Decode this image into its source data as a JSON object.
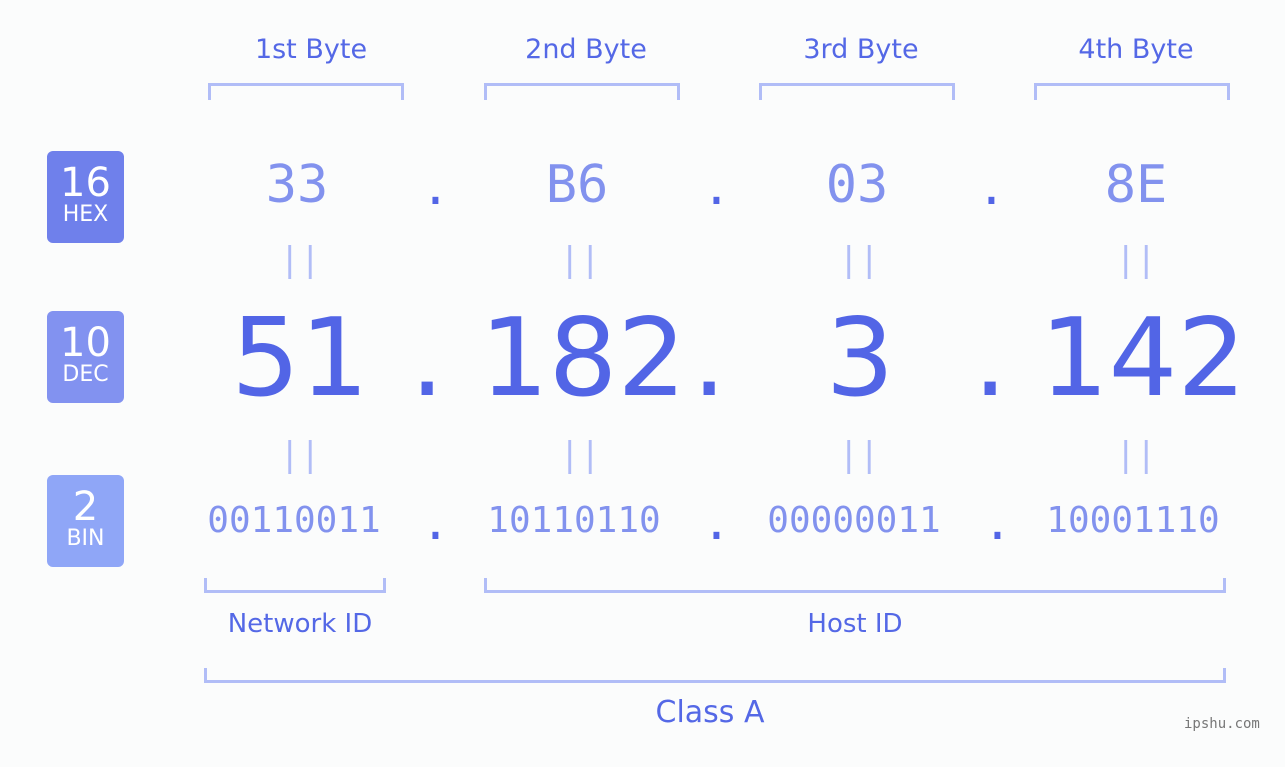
{
  "bytes": [
    {
      "label": "1st Byte",
      "hex": "33",
      "dec": "51",
      "bin": "00110011"
    },
    {
      "label": "2nd Byte",
      "hex": "B6",
      "dec": "182",
      "bin": "10110110"
    },
    {
      "label": "3rd Byte",
      "hex": "03",
      "dec": "3",
      "bin": "00000011"
    },
    {
      "label": "4th Byte",
      "hex": "8E",
      "dec": "142",
      "bin": "10001110"
    }
  ],
  "separator": ".",
  "equals": "||",
  "badges": {
    "hex": {
      "num": "16",
      "label": "HEX",
      "color": "#6f80eb"
    },
    "dec": {
      "num": "10",
      "label": "DEC",
      "color": "#8292f0"
    },
    "bin": {
      "num": "2",
      "label": "BIN",
      "color": "#8fa6f7"
    }
  },
  "sections": {
    "network": "Network ID",
    "host": "Host ID",
    "class": "Class A"
  },
  "watermark": "ipshu.com"
}
